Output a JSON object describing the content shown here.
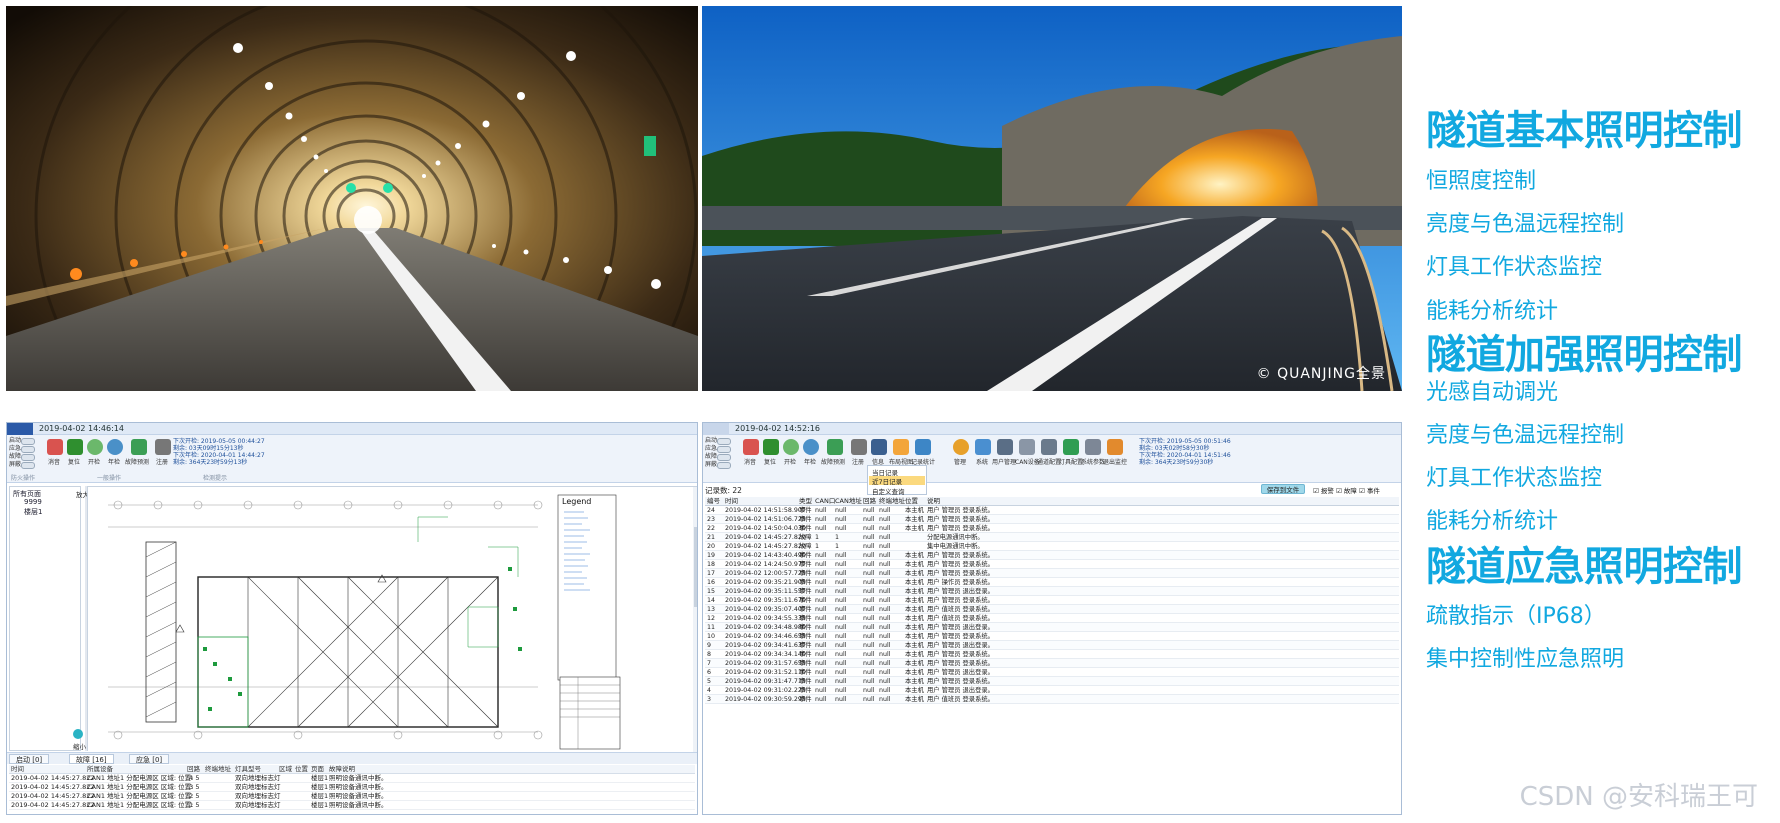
{
  "photos": {
    "watermark": "© QUANJING全景"
  },
  "right_panel": {
    "sections": [
      {
        "title": "隧道基本照明控制",
        "items": [
          "恒照度控制",
          "亮度与色温远程控制",
          "灯具工作状态监控",
          "能耗分析统计"
        ]
      },
      {
        "title": "隧道加强照明控制",
        "items": [
          "光感自动调光",
          "亮度与色温远程控制",
          "灯具工作状态监控",
          "能耗分析统计"
        ]
      },
      {
        "title": "隧道应急照明控制",
        "items": [
          "疏散指示（IP68）",
          "集中控制性应急照明"
        ]
      }
    ]
  },
  "screen_left": {
    "date": "2019-04-02 14:46:14",
    "side_buttons": [
      "启动",
      "应急",
      "故障",
      "屏蔽"
    ],
    "ribbon_buttons": [
      "消音",
      "复位",
      "开检",
      "年检",
      "故障预测",
      "注册"
    ],
    "ribbon_group1": "防火操作",
    "ribbon_group2": "一般操作",
    "ribbon_group3": "检测提示",
    "info": [
      "下次开检: 2019-05-05 00:44:27",
      "剩余: 03天09时15分13秒",
      "下次年检: 2020-04-01 14:44:27",
      "剩余: 364天23时59分13秒"
    ],
    "tree": [
      "所有页面",
      "9999",
      "楼层1"
    ],
    "zoom_in": "放大",
    "zoom_out": "缩小",
    "legend": "Legend",
    "tabs": [
      {
        "label": "启动 [0]"
      },
      {
        "label": "故障 [16]"
      },
      {
        "label": "应急 [0]"
      }
    ],
    "table_headers": [
      "时间",
      "所属设备",
      "回路",
      "终端地址",
      "灯具型号",
      "区域",
      "位置",
      "页面",
      "故障说明"
    ],
    "rows": [
      [
        "2019-04-02 14:45:27.822",
        "CAN1 地址1 分配电源区 区域: 位置: 5",
        "4",
        "",
        "双向地埋标志灯",
        "",
        "",
        "楼层1",
        "照明设备通讯中断。"
      ],
      [
        "2019-04-02 14:45:27.822",
        "CAN1 地址1 分配电源区 区域: 位置: 5",
        "3",
        "",
        "双向地埋标志灯",
        "",
        "",
        "楼层1",
        "照明设备通讯中断。"
      ],
      [
        "2019-04-02 14:45:27.822",
        "CAN1 地址1 分配电源区 区域: 位置: 5",
        "2",
        "",
        "双向地埋标志灯",
        "",
        "",
        "楼层1",
        "照明设备通讯中断。"
      ],
      [
        "2019-04-02 14:45:27.822",
        "CAN1 地址1 分配电源区 区域: 位置: 5",
        "1",
        "",
        "双向地埋标志灯",
        "",
        "",
        "楼层1",
        "照明设备通讯中断。"
      ]
    ]
  },
  "screen_right": {
    "date": "2019-04-02 14:52:16",
    "side_buttons": [
      "启动",
      "应急",
      "故障",
      "屏蔽"
    ],
    "ribbon_buttons": [
      "消音",
      "复位",
      "开检",
      "年检",
      "故障预测",
      "注册",
      "信息",
      "布局视图",
      "记录统计",
      "管理",
      "系统",
      "用户管理",
      "CAN设备",
      "通道配置",
      "灯具配置",
      "系统参数",
      "退出监控"
    ],
    "info": [
      "下次开检: 2019-05-05 00:51:46",
      "剩余: 03天02时58分30秒",
      "下次年检: 2020-04-01 14:51:46",
      "剩余: 364天23时59分30秒"
    ],
    "dropdown": [
      "当日记录",
      "近7日记录",
      "自定义查询"
    ],
    "record_count": "记录数: 22",
    "save_button": "保存到文件",
    "checks": [
      "报警",
      "故障",
      "事件"
    ],
    "headers": [
      "编号",
      "时间",
      "类型",
      "CAN口",
      "CAN地址",
      "回路",
      "终端地址",
      "位置",
      "说明"
    ],
    "rows": [
      [
        "24",
        "2019-04-02 14:51:58.907",
        "事件",
        "null",
        "null",
        "null",
        "null",
        "本主机",
        "用户 管理员 登录系统。"
      ],
      [
        "23",
        "2019-04-02 14:51:06.723",
        "事件",
        "null",
        "null",
        "null",
        "null",
        "本主机",
        "用户 管理员 登录系统。"
      ],
      [
        "22",
        "2019-04-02 14:50:04.030",
        "事件",
        "null",
        "null",
        "null",
        "null",
        "本主机",
        "用户 管理员 登录系统。"
      ],
      [
        "21",
        "2019-04-02 14:45:27.820",
        "故障",
        "1",
        "1",
        "null",
        "null",
        "",
        "分配电源通讯中断。"
      ],
      [
        "20",
        "2019-04-02 14:45:27.820",
        "故障",
        "1",
        "1",
        "null",
        "null",
        "",
        "集中电源通讯中断。"
      ],
      [
        "19",
        "2019-04-02 14:43:40.490",
        "事件",
        "null",
        "null",
        "null",
        "null",
        "本主机",
        "用户 管理员 登录系统。"
      ],
      [
        "18",
        "2019-04-02 14:24:50.977",
        "事件",
        "null",
        "null",
        "null",
        "null",
        "本主机",
        "用户 管理员 登录系统。"
      ],
      [
        "17",
        "2019-04-02 12:00:57.723",
        "事件",
        "null",
        "null",
        "null",
        "null",
        "本主机",
        "用户 管理员 登录系统。"
      ],
      [
        "16",
        "2019-04-02 09:35:21.903",
        "事件",
        "null",
        "null",
        "null",
        "null",
        "本主机",
        "用户 操作员 登录系统。"
      ],
      [
        "15",
        "2019-04-02 09:35:11.557",
        "事件",
        "null",
        "null",
        "null",
        "null",
        "本主机",
        "用户 管理员 退出登录。"
      ],
      [
        "14",
        "2019-04-02 09:35:11.670",
        "事件",
        "null",
        "null",
        "null",
        "null",
        "本主机",
        "用户 管理员 登录系统。"
      ],
      [
        "13",
        "2019-04-02 09:35:07.407",
        "事件",
        "null",
        "null",
        "null",
        "null",
        "本主机",
        "用户 值班员 登录系统。"
      ],
      [
        "12",
        "2019-04-02 09:34:55.333",
        "事件",
        "null",
        "null",
        "null",
        "null",
        "本主机",
        "用户 值班员 登录系统。"
      ],
      [
        "11",
        "2019-04-02 09:34:48.980",
        "事件",
        "null",
        "null",
        "null",
        "null",
        "本主机",
        "用户 管理员 退出登录。"
      ],
      [
        "10",
        "2019-04-02 09:34:46.653",
        "事件",
        "null",
        "null",
        "null",
        "null",
        "本主机",
        "用户 管理员 登录系统。"
      ],
      [
        "9",
        "2019-04-02 09:34:41.637",
        "事件",
        "null",
        "null",
        "null",
        "null",
        "本主机",
        "用户 管理员 退出登录。"
      ],
      [
        "8",
        "2019-04-02 09:34:34.140",
        "事件",
        "null",
        "null",
        "null",
        "null",
        "本主机",
        "用户 管理员 登录系统。"
      ],
      [
        "7",
        "2019-04-02 09:31:57.653",
        "事件",
        "null",
        "null",
        "null",
        "null",
        "本主机",
        "用户 管理员 登录系统。"
      ],
      [
        "6",
        "2019-04-02 09:31:52.110",
        "事件",
        "null",
        "null",
        "null",
        "null",
        "本主机",
        "用户 管理员 退出登录。"
      ],
      [
        "5",
        "2019-04-02 09:31:47.713",
        "事件",
        "null",
        "null",
        "null",
        "null",
        "本主机",
        "用户 管理员 登录系统。"
      ],
      [
        "4",
        "2019-04-02 09:31:02.223",
        "事件",
        "null",
        "null",
        "null",
        "null",
        "本主机",
        "用户 管理员 退出登录。"
      ],
      [
        "3",
        "2019-04-02 09:30:59.293",
        "事件",
        "null",
        "null",
        "null",
        "null",
        "本主机",
        "用户 值班员 登录系统。"
      ]
    ]
  },
  "footer_watermark": "CSDN @安科瑞王可",
  "colors": {
    "accent": "#11a8e0",
    "ui_border": "#a9bdd6"
  }
}
